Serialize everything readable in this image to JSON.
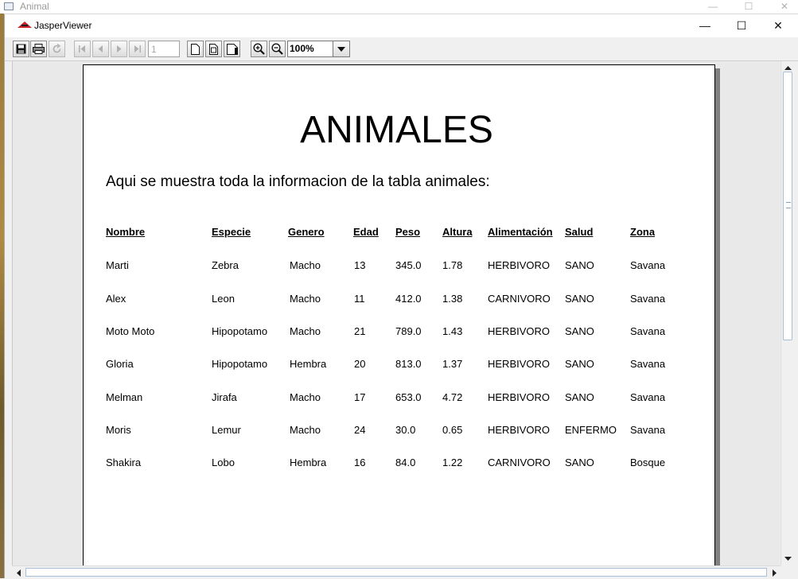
{
  "outer_window": {
    "title": "Animal",
    "controls": [
      "—",
      "☐",
      "✕"
    ]
  },
  "window": {
    "title": "JasperViewer",
    "controls": {
      "minimize": "—",
      "maximize": "☐",
      "close": "✕"
    }
  },
  "toolbar": {
    "save": "save-icon",
    "print": "print-icon",
    "reload": "reload-icon",
    "first_page": "first-page-icon",
    "prev_page": "previous-page-icon",
    "next_page": "next-page-icon",
    "last_page": "last-page-icon",
    "page_number": "1",
    "actual_size": "actual-size-icon",
    "fit_page": "fit-page-icon",
    "fit_width": "fit-width-icon",
    "zoom_in": "zoom-in-icon",
    "zoom_out": "zoom-out-icon",
    "zoom_value": "100%"
  },
  "report": {
    "title": "ANIMALES",
    "subtitle": "Aqui se muestra toda la informacion de la tabla animales:",
    "columns": [
      "Nombre",
      "Especie",
      "Genero",
      "Edad",
      "Peso",
      "Altura",
      "Alimentación",
      "Salud",
      "Zona"
    ],
    "rows": [
      [
        "Marti",
        "Zebra",
        "Macho",
        "13",
        "345.0",
        "1.78",
        "HERBIVORO",
        "SANO",
        "Savana"
      ],
      [
        "Alex",
        "Leon",
        "Macho",
        "11",
        "412.0",
        "1.38",
        "CARNIVORO",
        "SANO",
        "Savana"
      ],
      [
        "Moto Moto",
        "Hipopotamo",
        "Macho",
        "21",
        "789.0",
        "1.43",
        "HERBIVORO",
        "SANO",
        "Savana"
      ],
      [
        "Gloria",
        "Hipopotamo",
        "Hembra",
        "20",
        "813.0",
        "1.37",
        "HERBIVORO",
        "SANO",
        "Savana"
      ],
      [
        "Melman",
        "Jirafa",
        "Macho",
        "17",
        "653.0",
        "4.72",
        "HERBIVORO",
        "SANO",
        "Savana"
      ],
      [
        "Moris",
        "Lemur",
        "Macho",
        "24",
        "30.0",
        "0.65",
        "HERBIVORO",
        "ENFERMO",
        "Savana"
      ],
      [
        "Shakira",
        "Lobo",
        "Hembra",
        "16",
        "84.0",
        "1.22",
        "CARNIVORO",
        "SANO",
        "Bosque"
      ]
    ]
  },
  "scrollbars": {
    "vertical": "vertical-scrollbar",
    "horizontal": "horizontal-scrollbar"
  }
}
